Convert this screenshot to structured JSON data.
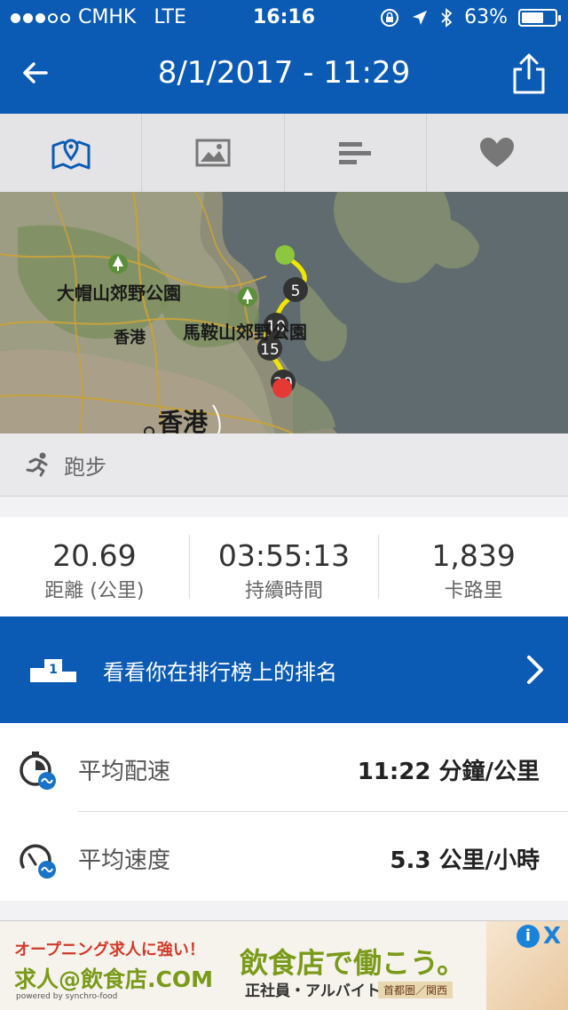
{
  "status_bar": {
    "carrier": "CMHK",
    "network": "LTE",
    "time": "16:16",
    "battery": "63%",
    "signal_bars": 3,
    "signal_total": 5
  },
  "nav": {
    "title": "8/1/2017 - 11:29",
    "back_icon": "arrow-left-icon",
    "share_icon": "share-icon"
  },
  "tabs": [
    {
      "icon": "map-pin-icon",
      "active": true
    },
    {
      "icon": "image-icon",
      "active": false
    },
    {
      "icon": "bars-icon",
      "active": false
    },
    {
      "icon": "heart-icon",
      "active": false
    }
  ],
  "map": {
    "labels": {
      "park1": "大帽山郊野公園",
      "park2": "馬鞍山郊野公園",
      "district1": "香港",
      "city": "香港"
    },
    "markers": [
      "5",
      "10",
      "15",
      "20"
    ]
  },
  "activity": {
    "type": "跑步",
    "icon": "running-icon"
  },
  "stats": [
    {
      "value": "20.69",
      "label": "距離 (公里)"
    },
    {
      "value": "03:55:13",
      "label": "持續時間"
    },
    {
      "value": "1,839",
      "label": "卡路里"
    }
  ],
  "leaderboard": {
    "text": "看看你在排行榜上的排名",
    "podium_number": "1"
  },
  "metrics": [
    {
      "label": "平均配速",
      "value": "11:22 分鐘/公里",
      "icon": "stopwatch-icon"
    },
    {
      "label": "平均速度",
      "value": "5.3 公里/小時",
      "icon": "speedometer-icon"
    }
  ],
  "ad": {
    "line1": "オープニング求人に強い！",
    "line2": "求人@飲食店.COM",
    "line3": "powered by synchro-food",
    "headline": "飲食店で働こう。",
    "subline": "正社員・アルバイト",
    "tag": "首都圏／関西",
    "info": "i",
    "close": "X"
  },
  "colors": {
    "brand_blue": "#0b5bb5",
    "start_marker": "#8dc63f",
    "end_marker": "#e53935",
    "route": "#f2e600"
  }
}
